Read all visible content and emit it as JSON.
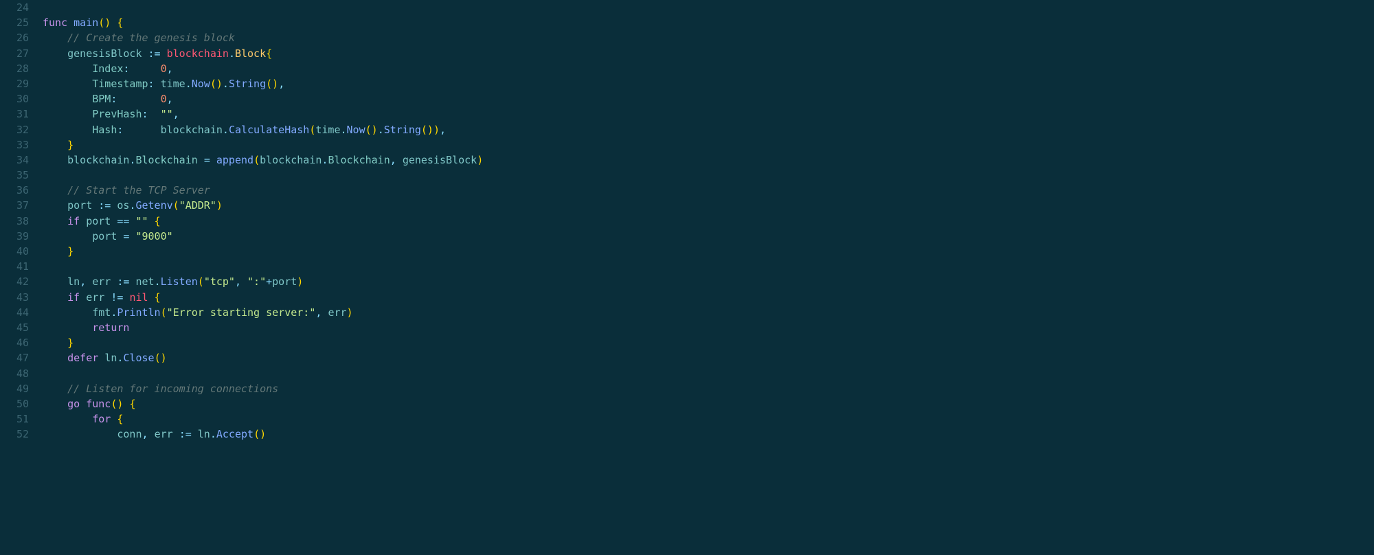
{
  "lines": [
    {
      "num": "24",
      "tokens": []
    },
    {
      "num": "25",
      "tokens": [
        {
          "c": "kw",
          "t": "func"
        },
        {
          "c": "white",
          "t": " "
        },
        {
          "c": "fn",
          "t": "main"
        },
        {
          "c": "brace",
          "t": "()"
        },
        {
          "c": "white",
          "t": " "
        },
        {
          "c": "brace",
          "t": "{"
        }
      ]
    },
    {
      "num": "26",
      "tokens": [
        {
          "c": "white",
          "t": "    "
        },
        {
          "c": "cmt",
          "t": "// Create the genesis block"
        }
      ]
    },
    {
      "num": "27",
      "tokens": [
        {
          "c": "white",
          "t": "    "
        },
        {
          "c": "ident",
          "t": "genesisBlock"
        },
        {
          "c": "white",
          "t": " "
        },
        {
          "c": "punct",
          "t": ":="
        },
        {
          "c": "white",
          "t": " "
        },
        {
          "c": "red",
          "t": "blockchain"
        },
        {
          "c": "punct",
          "t": "."
        },
        {
          "c": "type",
          "t": "Block"
        },
        {
          "c": "brace",
          "t": "{"
        }
      ]
    },
    {
      "num": "28",
      "tokens": [
        {
          "c": "white",
          "t": "        "
        },
        {
          "c": "field",
          "t": "Index"
        },
        {
          "c": "punct",
          "t": ":"
        },
        {
          "c": "white",
          "t": "     "
        },
        {
          "c": "num",
          "t": "0"
        },
        {
          "c": "punct",
          "t": ","
        }
      ]
    },
    {
      "num": "29",
      "tokens": [
        {
          "c": "white",
          "t": "        "
        },
        {
          "c": "field",
          "t": "Timestamp"
        },
        {
          "c": "punct",
          "t": ":"
        },
        {
          "c": "white",
          "t": " "
        },
        {
          "c": "ident",
          "t": "time"
        },
        {
          "c": "punct",
          "t": "."
        },
        {
          "c": "fn",
          "t": "Now"
        },
        {
          "c": "brace",
          "t": "()"
        },
        {
          "c": "punct",
          "t": "."
        },
        {
          "c": "fn",
          "t": "String"
        },
        {
          "c": "brace",
          "t": "()"
        },
        {
          "c": "punct",
          "t": ","
        }
      ]
    },
    {
      "num": "30",
      "tokens": [
        {
          "c": "white",
          "t": "        "
        },
        {
          "c": "field",
          "t": "BPM"
        },
        {
          "c": "punct",
          "t": ":"
        },
        {
          "c": "white",
          "t": "       "
        },
        {
          "c": "num",
          "t": "0"
        },
        {
          "c": "punct",
          "t": ","
        }
      ]
    },
    {
      "num": "31",
      "tokens": [
        {
          "c": "white",
          "t": "        "
        },
        {
          "c": "field",
          "t": "PrevHash"
        },
        {
          "c": "punct",
          "t": ":"
        },
        {
          "c": "white",
          "t": "  "
        },
        {
          "c": "str",
          "t": "\"\""
        },
        {
          "c": "punct",
          "t": ","
        }
      ]
    },
    {
      "num": "32",
      "tokens": [
        {
          "c": "white",
          "t": "        "
        },
        {
          "c": "field",
          "t": "Hash"
        },
        {
          "c": "punct",
          "t": ":"
        },
        {
          "c": "white",
          "t": "      "
        },
        {
          "c": "ident",
          "t": "blockchain"
        },
        {
          "c": "punct",
          "t": "."
        },
        {
          "c": "fn",
          "t": "CalculateHash"
        },
        {
          "c": "brace",
          "t": "("
        },
        {
          "c": "ident",
          "t": "time"
        },
        {
          "c": "punct",
          "t": "."
        },
        {
          "c": "fn",
          "t": "Now"
        },
        {
          "c": "brace",
          "t": "()"
        },
        {
          "c": "punct",
          "t": "."
        },
        {
          "c": "fn",
          "t": "String"
        },
        {
          "c": "brace",
          "t": "()"
        },
        {
          "c": "brace",
          "t": ")"
        },
        {
          "c": "punct",
          "t": ","
        }
      ]
    },
    {
      "num": "33",
      "tokens": [
        {
          "c": "white",
          "t": "    "
        },
        {
          "c": "brace",
          "t": "}"
        }
      ]
    },
    {
      "num": "34",
      "tokens": [
        {
          "c": "white",
          "t": "    "
        },
        {
          "c": "ident",
          "t": "blockchain"
        },
        {
          "c": "punct",
          "t": "."
        },
        {
          "c": "field",
          "t": "Blockchain"
        },
        {
          "c": "white",
          "t": " "
        },
        {
          "c": "punct",
          "t": "="
        },
        {
          "c": "white",
          "t": " "
        },
        {
          "c": "fn",
          "t": "append"
        },
        {
          "c": "brace",
          "t": "("
        },
        {
          "c": "ident",
          "t": "blockchain"
        },
        {
          "c": "punct",
          "t": "."
        },
        {
          "c": "field",
          "t": "Blockchain"
        },
        {
          "c": "punct",
          "t": ","
        },
        {
          "c": "white",
          "t": " "
        },
        {
          "c": "ident",
          "t": "genesisBlock"
        },
        {
          "c": "brace",
          "t": ")"
        }
      ]
    },
    {
      "num": "35",
      "tokens": []
    },
    {
      "num": "36",
      "tokens": [
        {
          "c": "white",
          "t": "    "
        },
        {
          "c": "cmt",
          "t": "// Start the TCP Server"
        }
      ]
    },
    {
      "num": "37",
      "tokens": [
        {
          "c": "white",
          "t": "    "
        },
        {
          "c": "ident",
          "t": "port"
        },
        {
          "c": "white",
          "t": " "
        },
        {
          "c": "punct",
          "t": ":="
        },
        {
          "c": "white",
          "t": " "
        },
        {
          "c": "ident",
          "t": "os"
        },
        {
          "c": "punct",
          "t": "."
        },
        {
          "c": "fn",
          "t": "Getenv"
        },
        {
          "c": "brace",
          "t": "("
        },
        {
          "c": "str",
          "t": "\"ADDR\""
        },
        {
          "c": "brace",
          "t": ")"
        }
      ]
    },
    {
      "num": "38",
      "tokens": [
        {
          "c": "white",
          "t": "    "
        },
        {
          "c": "kw",
          "t": "if"
        },
        {
          "c": "white",
          "t": " "
        },
        {
          "c": "ident",
          "t": "port"
        },
        {
          "c": "white",
          "t": " "
        },
        {
          "c": "punct",
          "t": "=="
        },
        {
          "c": "white",
          "t": " "
        },
        {
          "c": "str",
          "t": "\"\""
        },
        {
          "c": "white",
          "t": " "
        },
        {
          "c": "brace",
          "t": "{"
        }
      ]
    },
    {
      "num": "39",
      "tokens": [
        {
          "c": "white",
          "t": "        "
        },
        {
          "c": "ident",
          "t": "port"
        },
        {
          "c": "white",
          "t": " "
        },
        {
          "c": "punct",
          "t": "="
        },
        {
          "c": "white",
          "t": " "
        },
        {
          "c": "str",
          "t": "\"9000\""
        }
      ]
    },
    {
      "num": "40",
      "tokens": [
        {
          "c": "white",
          "t": "    "
        },
        {
          "c": "brace",
          "t": "}"
        }
      ]
    },
    {
      "num": "41",
      "tokens": []
    },
    {
      "num": "42",
      "tokens": [
        {
          "c": "white",
          "t": "    "
        },
        {
          "c": "ident",
          "t": "ln"
        },
        {
          "c": "punct",
          "t": ","
        },
        {
          "c": "white",
          "t": " "
        },
        {
          "c": "ident",
          "t": "err"
        },
        {
          "c": "white",
          "t": " "
        },
        {
          "c": "punct",
          "t": ":="
        },
        {
          "c": "white",
          "t": " "
        },
        {
          "c": "ident",
          "t": "net"
        },
        {
          "c": "punct",
          "t": "."
        },
        {
          "c": "fn",
          "t": "Listen"
        },
        {
          "c": "brace",
          "t": "("
        },
        {
          "c": "str",
          "t": "\"tcp\""
        },
        {
          "c": "punct",
          "t": ","
        },
        {
          "c": "white",
          "t": " "
        },
        {
          "c": "str",
          "t": "\":\""
        },
        {
          "c": "punct",
          "t": "+"
        },
        {
          "c": "ident",
          "t": "port"
        },
        {
          "c": "brace",
          "t": ")"
        }
      ]
    },
    {
      "num": "43",
      "tokens": [
        {
          "c": "white",
          "t": "    "
        },
        {
          "c": "kw",
          "t": "if"
        },
        {
          "c": "white",
          "t": " "
        },
        {
          "c": "ident",
          "t": "err"
        },
        {
          "c": "white",
          "t": " "
        },
        {
          "c": "punct",
          "t": "!="
        },
        {
          "c": "white",
          "t": " "
        },
        {
          "c": "red",
          "t": "nil"
        },
        {
          "c": "white",
          "t": " "
        },
        {
          "c": "brace",
          "t": "{"
        }
      ]
    },
    {
      "num": "44",
      "tokens": [
        {
          "c": "white",
          "t": "        "
        },
        {
          "c": "ident",
          "t": "fmt"
        },
        {
          "c": "punct",
          "t": "."
        },
        {
          "c": "fn",
          "t": "Println"
        },
        {
          "c": "brace",
          "t": "("
        },
        {
          "c": "str",
          "t": "\"Error starting server:\""
        },
        {
          "c": "punct",
          "t": ","
        },
        {
          "c": "white",
          "t": " "
        },
        {
          "c": "ident",
          "t": "err"
        },
        {
          "c": "brace",
          "t": ")"
        }
      ]
    },
    {
      "num": "45",
      "tokens": [
        {
          "c": "white",
          "t": "        "
        },
        {
          "c": "kw",
          "t": "return"
        }
      ]
    },
    {
      "num": "46",
      "tokens": [
        {
          "c": "white",
          "t": "    "
        },
        {
          "c": "brace",
          "t": "}"
        }
      ]
    },
    {
      "num": "47",
      "tokens": [
        {
          "c": "white",
          "t": "    "
        },
        {
          "c": "kw",
          "t": "defer"
        },
        {
          "c": "white",
          "t": " "
        },
        {
          "c": "ident",
          "t": "ln"
        },
        {
          "c": "punct",
          "t": "."
        },
        {
          "c": "fn",
          "t": "Close"
        },
        {
          "c": "brace",
          "t": "()"
        }
      ]
    },
    {
      "num": "48",
      "tokens": []
    },
    {
      "num": "49",
      "tokens": [
        {
          "c": "white",
          "t": "    "
        },
        {
          "c": "cmt",
          "t": "// Listen for incoming connections"
        }
      ]
    },
    {
      "num": "50",
      "tokens": [
        {
          "c": "white",
          "t": "    "
        },
        {
          "c": "kw",
          "t": "go"
        },
        {
          "c": "white",
          "t": " "
        },
        {
          "c": "kw",
          "t": "func"
        },
        {
          "c": "brace",
          "t": "()"
        },
        {
          "c": "white",
          "t": " "
        },
        {
          "c": "brace",
          "t": "{"
        }
      ]
    },
    {
      "num": "51",
      "tokens": [
        {
          "c": "white",
          "t": "        "
        },
        {
          "c": "kw",
          "t": "for"
        },
        {
          "c": "white",
          "t": " "
        },
        {
          "c": "brace",
          "t": "{"
        }
      ]
    },
    {
      "num": "52",
      "tokens": [
        {
          "c": "white",
          "t": "            "
        },
        {
          "c": "ident",
          "t": "conn"
        },
        {
          "c": "punct",
          "t": ","
        },
        {
          "c": "white",
          "t": " "
        },
        {
          "c": "ident",
          "t": "err"
        },
        {
          "c": "white",
          "t": " "
        },
        {
          "c": "punct",
          "t": ":="
        },
        {
          "c": "white",
          "t": " "
        },
        {
          "c": "ident",
          "t": "ln"
        },
        {
          "c": "punct",
          "t": "."
        },
        {
          "c": "fn",
          "t": "Accept"
        },
        {
          "c": "brace",
          "t": "()"
        }
      ]
    }
  ]
}
